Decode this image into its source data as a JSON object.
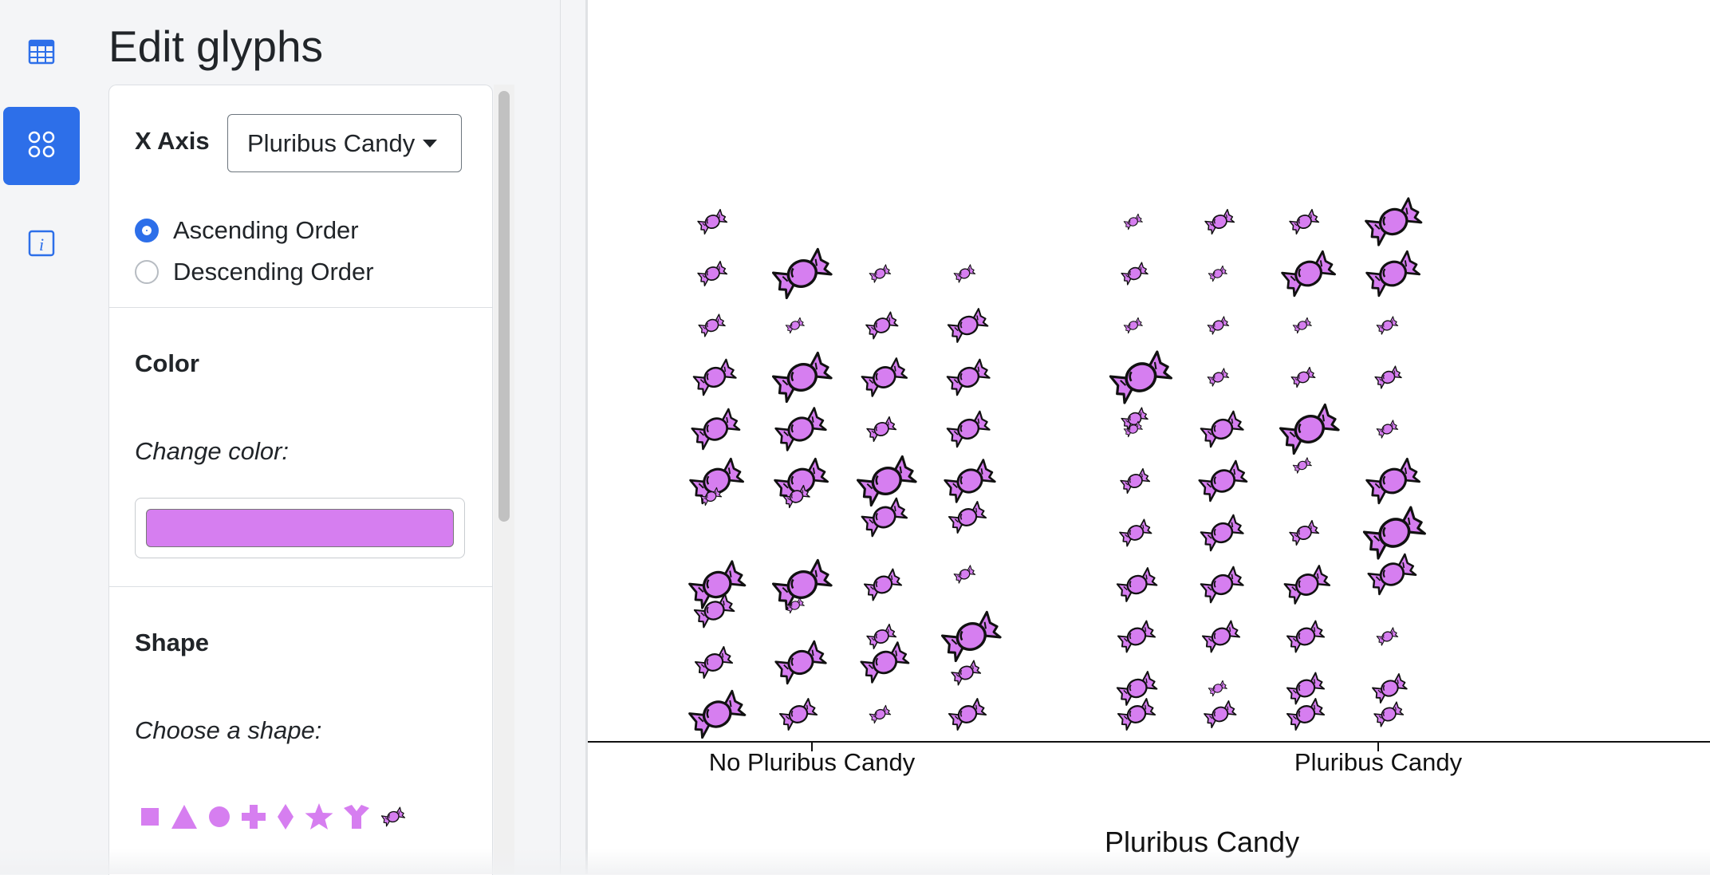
{
  "page": {
    "title": "Edit glyphs"
  },
  "sidebar": {
    "items": [
      {
        "name": "table-icon",
        "active": false
      },
      {
        "name": "glyph-grid-icon",
        "active": true
      },
      {
        "name": "info-icon",
        "active": false
      }
    ],
    "accent": "#2d6fe9"
  },
  "panel": {
    "x_axis": {
      "label": "X Axis",
      "selected": "Pluribus Candy"
    },
    "order": {
      "ascending_label": "Ascending Order",
      "descending_label": "Descending Order",
      "selected": "ascending"
    },
    "color": {
      "heading": "Color",
      "prompt": "Change color:",
      "value": "#d67ef0"
    },
    "shape": {
      "heading": "Shape",
      "prompt": "Choose a shape:",
      "options": [
        "square",
        "triangle",
        "circle",
        "plus",
        "diamond",
        "star",
        "y-shape",
        "candy"
      ]
    }
  },
  "chart_data": {
    "type": "scatter",
    "xlabel": "Pluribus Candy",
    "categories": [
      "No Pluribus Candy",
      "Pluribus Candy"
    ],
    "glyph": "candy",
    "glyph_color": "#d67ef0",
    "groups": [
      {
        "category": "No Pluribus Candy",
        "columns": [
          {
            "glyphs": [
              [
                9,
                0.55
              ],
              [
                8,
                0.55
              ],
              [
                7,
                0.5
              ],
              [
                6,
                0.8
              ],
              [
                5,
                0.9
              ],
              [
                4,
                1.0
              ],
              [
                3.7,
                0.4
              ],
              [
                2,
                1.05
              ],
              [
                1.5,
                0.75
              ],
              [
                0.5,
                0.7
              ],
              [
                -0.5,
                1.05
              ]
            ]
          },
          {
            "glyphs": [
              [
                8,
                1.1
              ],
              [
                7,
                0.35
              ],
              [
                6,
                1.1
              ],
              [
                5,
                0.95
              ],
              [
                4,
                1.0
              ],
              [
                3.7,
                0.5
              ],
              [
                2,
                1.1
              ],
              [
                1.6,
                0.35
              ],
              [
                0.5,
                0.95
              ],
              [
                -0.5,
                0.7
              ]
            ]
          },
          {
            "glyphs": [
              [
                8,
                0.4
              ],
              [
                7,
                0.6
              ],
              [
                6,
                0.85
              ],
              [
                5,
                0.55
              ],
              [
                4,
                1.1
              ],
              [
                3.3,
                0.85
              ],
              [
                2,
                0.7
              ],
              [
                1,
                0.55
              ],
              [
                0.5,
                0.9
              ],
              [
                -0.5,
                0.4
              ]
            ]
          },
          {
            "glyphs": [
              [
                8,
                0.4
              ],
              [
                7,
                0.75
              ],
              [
                6,
                0.8
              ],
              [
                5,
                0.8
              ],
              [
                4,
                0.95
              ],
              [
                3.3,
                0.7
              ],
              [
                2.2,
                0.4
              ],
              [
                1,
                1.1
              ],
              [
                0.3,
                0.55
              ],
              [
                -0.5,
                0.7
              ]
            ]
          }
        ]
      },
      {
        "category": "Pluribus Candy",
        "columns": [
          {
            "glyphs": [
              [
                9,
                0.35
              ],
              [
                8,
                0.5
              ],
              [
                7,
                0.35
              ],
              [
                6,
                1.15
              ],
              [
                5.2,
                0.5
              ],
              [
                5,
                0.35
              ],
              [
                4,
                0.55
              ],
              [
                3,
                0.6
              ],
              [
                2,
                0.75
              ],
              [
                1,
                0.7
              ],
              [
                0,
                0.75
              ],
              [
                -0.5,
                0.7
              ]
            ]
          },
          {
            "glyphs": [
              [
                9,
                0.55
              ],
              [
                8,
                0.35
              ],
              [
                7,
                0.4
              ],
              [
                6,
                0.4
              ],
              [
                5,
                0.8
              ],
              [
                4,
                0.9
              ],
              [
                3,
                0.8
              ],
              [
                2,
                0.8
              ],
              [
                1,
                0.7
              ],
              [
                0,
                0.35
              ],
              [
                -0.5,
                0.6
              ]
            ]
          },
          {
            "glyphs": [
              [
                9,
                0.55
              ],
              [
                8,
                1.0
              ],
              [
                7,
                0.35
              ],
              [
                6,
                0.45
              ],
              [
                5,
                1.1
              ],
              [
                4.3,
                0.35
              ],
              [
                3,
                0.55
              ],
              [
                2,
                0.85
              ],
              [
                1,
                0.7
              ],
              [
                0,
                0.7
              ],
              [
                -0.5,
                0.7
              ]
            ]
          },
          {
            "glyphs": [
              [
                9,
                1.05
              ],
              [
                8,
                1.0
              ],
              [
                7,
                0.4
              ],
              [
                6,
                0.5
              ],
              [
                5,
                0.4
              ],
              [
                4,
                1.0
              ],
              [
                3,
                1.15
              ],
              [
                2.2,
                0.9
              ],
              [
                1,
                0.4
              ],
              [
                0,
                0.65
              ],
              [
                -0.5,
                0.55
              ]
            ]
          }
        ]
      }
    ]
  }
}
